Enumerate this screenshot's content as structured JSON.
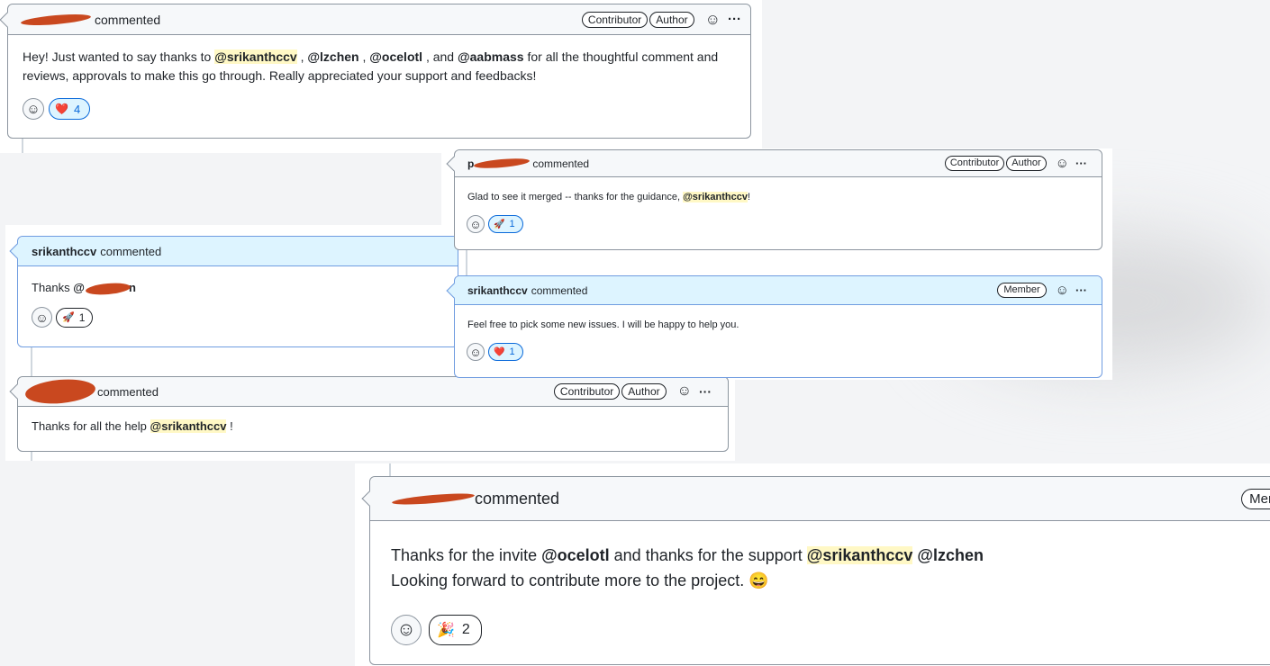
{
  "comments": [
    {
      "author_visible": "",
      "action": "commented",
      "badges": [
        "Contributor",
        "Author"
      ],
      "body": {
        "line1_pre": "Hey! Just wanted to say thanks to ",
        "m1": "@srikanthccv",
        "sep1": " , ",
        "m2": "@lzchen",
        "sep2": " , ",
        "m3": "@ocelotl",
        "sep3": " , and ",
        "m4": "@aabmass",
        "line1_post": " for all the thoughtful comment and",
        "line2": "reviews, approvals to make this go through. Really appreciated your support and feedbacks!"
      },
      "reaction": {
        "emoji": "❤️",
        "count": "4",
        "icon": "heart-icon"
      }
    },
    {
      "author_visible": "p",
      "action": "commented",
      "badges": [
        "Contributor",
        "Author"
      ],
      "body": {
        "pre": "Glad to see it merged -- thanks for the guidance, ",
        "m1": "@srikanthccv",
        "post": "!"
      },
      "reaction": {
        "emoji": "🚀",
        "count": "1",
        "icon": "rocket-icon"
      }
    },
    {
      "author": "srikanthccv",
      "action": "commented",
      "body": {
        "pre": "Thanks ",
        "m1_start": "@",
        "m1_end": "n"
      },
      "reaction": {
        "emoji": "🚀",
        "count": "1",
        "icon": "rocket-icon"
      }
    },
    {
      "author": "srikanthccv",
      "action": "commented",
      "badges": [
        "Member"
      ],
      "body": {
        "text": "Feel free to pick some new issues. I will be happy to help you."
      },
      "reaction": {
        "emoji": "❤️",
        "count": "1",
        "icon": "heart-icon"
      }
    },
    {
      "author_visible": "",
      "action": "commented",
      "badges": [
        "Contributor",
        "Author"
      ],
      "body": {
        "pre": "Thanks for all the help ",
        "m1": "@srikanthccv",
        "post": " !"
      }
    },
    {
      "author_visible": "",
      "action": "commented",
      "badges": [
        "Mer"
      ],
      "body": {
        "l1_pre": "Thanks for the invite ",
        "m1": "@ocelotl",
        "l1_mid": " and thanks for the support ",
        "m2": "@srikanthccv",
        "m3": "@lzchen",
        "line2": "Looking forward to contribute more to the project. ",
        "emoji": "😄"
      },
      "reaction": {
        "emoji": "🎉",
        "count": "2",
        "icon": "tada-icon"
      }
    }
  ],
  "icons": {
    "add_reaction": "smiley-icon",
    "more": "kebab-horizontal-icon",
    "smile_glyph": "☺",
    "more_glyph": "···"
  },
  "colors": {
    "mention_highlight": "#fff8c5",
    "member_border": "#6f9ce0",
    "redaction": "#c9481f",
    "reaction_active": "#0969da"
  }
}
